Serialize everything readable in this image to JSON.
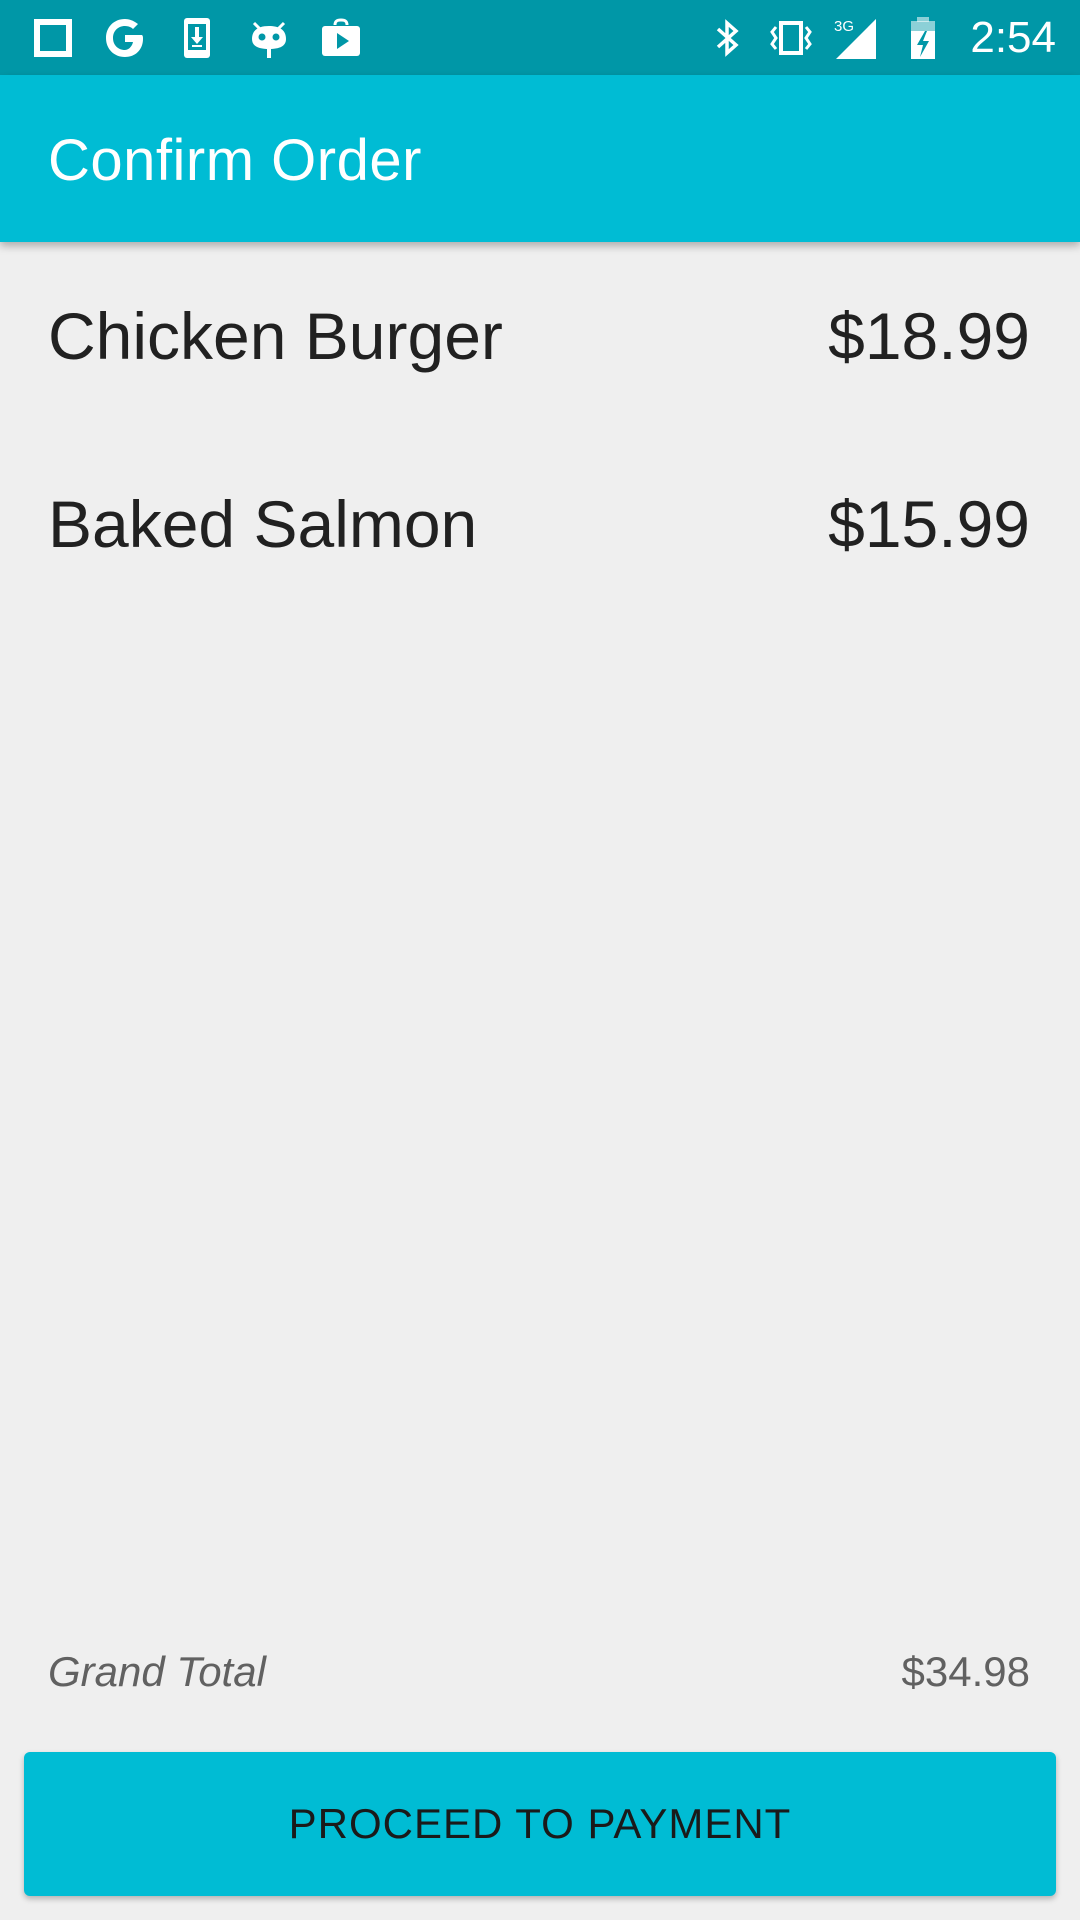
{
  "status_bar": {
    "time": "2:54",
    "network": "3G",
    "left_icons": [
      "square-notification-icon",
      "google-icon",
      "download-icon",
      "android-icon",
      "play-store-icon"
    ],
    "right_icons": [
      "bluetooth-icon",
      "vibrate-icon",
      "signal-icon",
      "battery-charging-icon"
    ],
    "background": "#0097a7"
  },
  "app_bar": {
    "title": "Confirm Order",
    "background": "#00bcd4"
  },
  "order": {
    "items": [
      {
        "name": "Chicken Burger",
        "price": "$18.99"
      },
      {
        "name": "Baked Salmon",
        "price": "$15.99"
      }
    ]
  },
  "summary": {
    "grand_total_label": "Grand Total",
    "grand_total_value": "$34.98"
  },
  "actions": {
    "proceed_label": "PROCEED TO PAYMENT",
    "button_color": "#00bcd4"
  }
}
